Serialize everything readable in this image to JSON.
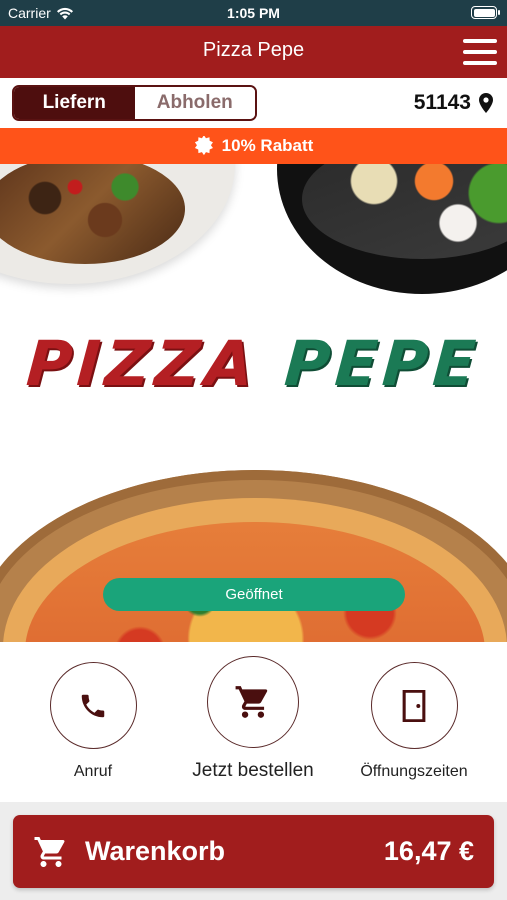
{
  "status_bar": {
    "carrier": "Carrier",
    "time": "1:05 PM",
    "wifi_icon": "wifi-icon",
    "battery_icon": "battery-icon"
  },
  "header": {
    "title": "Pizza Pepe",
    "menu_icon": "hamburger-menu-icon"
  },
  "order_mode": {
    "options": [
      "Liefern",
      "Abholen"
    ],
    "selected": "Liefern",
    "postal_code": "51143",
    "location_icon": "map-pin-icon"
  },
  "promo": {
    "text": "10% Rabatt",
    "icon": "badge-icon"
  },
  "hero": {
    "logo_word1": "PIZZA",
    "logo_word2": "PEPE",
    "status": "Geöffnet"
  },
  "actions": [
    {
      "label": "Anruf",
      "icon": "phone-icon"
    },
    {
      "label": "Jetzt bestellen",
      "icon": "cart-icon"
    },
    {
      "label": "Öffnungszeiten",
      "icon": "door-icon"
    }
  ],
  "cart": {
    "label": "Warenkorb",
    "total": "16,47 €",
    "icon": "cart-icon"
  },
  "colors": {
    "brand_red": "#a11d1d",
    "promo_orange": "#ff5319",
    "open_green": "#1aa47a",
    "status_bar": "#1f3e48"
  }
}
